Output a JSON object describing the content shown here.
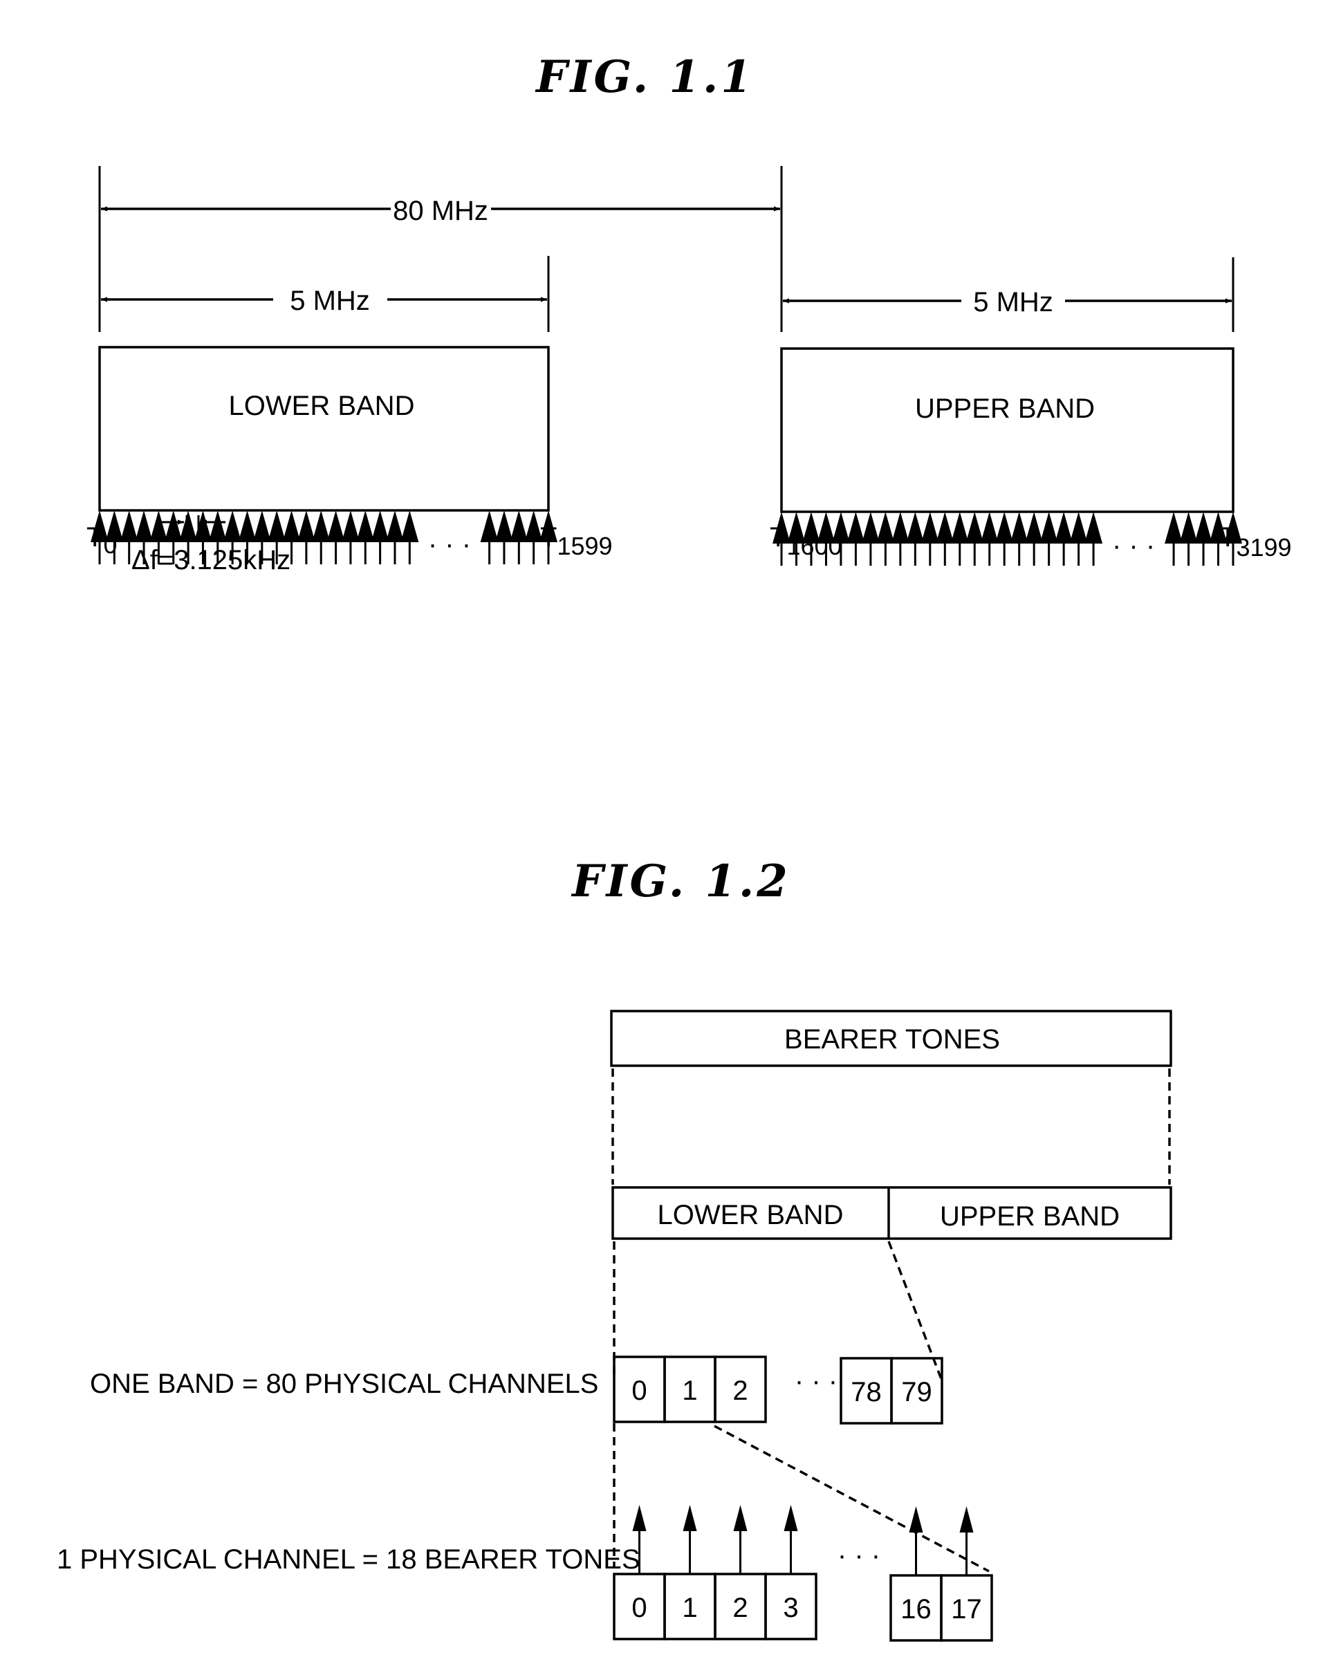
{
  "fig1": {
    "title": "FIG. 1.1",
    "span_total_label": "80 MHz",
    "lower": {
      "width_label": "5 MHz",
      "band_label": "LOWER BAND",
      "first_tone": {
        "base": "T",
        "sub": "0"
      },
      "last_tone": {
        "base": "T",
        "sub": "1599"
      },
      "tones_before_ellipsis": 22,
      "tones_after_ellipsis": 5,
      "ellipsis": "· · ·",
      "spacing_label": "Δf=3.125kHz"
    },
    "upper": {
      "width_label": "5 MHz",
      "band_label": "UPPER BAND",
      "first_tone": {
        "base": "T",
        "sub": "1600"
      },
      "last_tone": {
        "base": "T",
        "sub": "3199"
      },
      "tones_before_ellipsis": 22,
      "tones_after_ellipsis": 5,
      "ellipsis": "· · ·"
    }
  },
  "fig2": {
    "title": "FIG. 1.2",
    "bearer_tones_label": "BEARER TONES",
    "lower_band_label": "LOWER BAND",
    "upper_band_label": "UPPER BAND",
    "band_row_label": "ONE BAND = 80 PHYSICAL CHANNELS",
    "band_channels_start": [
      "0",
      "1",
      "2"
    ],
    "band_channels_end": [
      "78",
      "79"
    ],
    "channel_row_label": "1 PHYSICAL CHANNEL = 18 BEARER TONES",
    "tones_start": [
      "0",
      "1",
      "2",
      "3"
    ],
    "tones_end": [
      "16",
      "17"
    ],
    "ellipsis": "· · ·"
  }
}
